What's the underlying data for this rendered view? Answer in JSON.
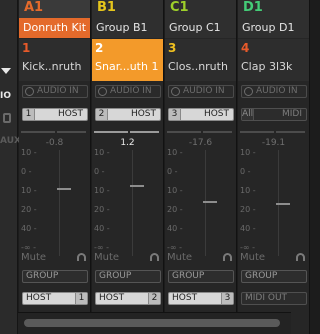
{
  "left": {
    "io": "IO",
    "aux": "AUX"
  },
  "groups": [
    {
      "letter": "A1",
      "name": "Donruth Kit",
      "color": "#e46a2b"
    },
    {
      "letter": "B1",
      "name": "Group B1",
      "color": "#e5c51c"
    },
    {
      "letter": "C1",
      "name": "Group C1",
      "color": "#9ed02a"
    },
    {
      "letter": "D1",
      "name": "Group D1",
      "color": "#44cc77"
    }
  ],
  "sounds": [
    {
      "num": "1",
      "name": "Kick..nruth",
      "num_color": "#e85a2a"
    },
    {
      "num": "2",
      "name": "Snar...uth 1",
      "num_color": "#ffffff"
    },
    {
      "num": "3",
      "name": "Clos..nruth",
      "num_color": "#f0c020"
    },
    {
      "num": "4",
      "name": "Clap 3l3k",
      "num_color": "#e85a2a"
    }
  ],
  "audio_in": "AUDIO IN",
  "host_rows": [
    {
      "num": "1",
      "text": "HOST"
    },
    {
      "num": "2",
      "text": "HOST"
    },
    {
      "num": "3",
      "text": "HOST"
    },
    {
      "num": "All",
      "text": "MIDI"
    }
  ],
  "faders": [
    {
      "db": "-0.8",
      "level": 0.62
    },
    {
      "db": "1.2",
      "level": 0.64
    },
    {
      "db": "-17.6",
      "level": 0.49
    },
    {
      "db": "-19.1",
      "level": 0.47
    }
  ],
  "ticks": [
    "10 -",
    "0 -",
    "10 -",
    "20 -",
    "40 -",
    "-∞ -"
  ],
  "mute": "Mute",
  "group_label": "GROUP",
  "outputs": [
    {
      "text": "HOST",
      "num": "1"
    },
    {
      "text": "HOST",
      "num": "2"
    },
    {
      "text": "HOST",
      "num": "3"
    },
    {
      "text": "MIDI OUT",
      "num": ""
    }
  ]
}
